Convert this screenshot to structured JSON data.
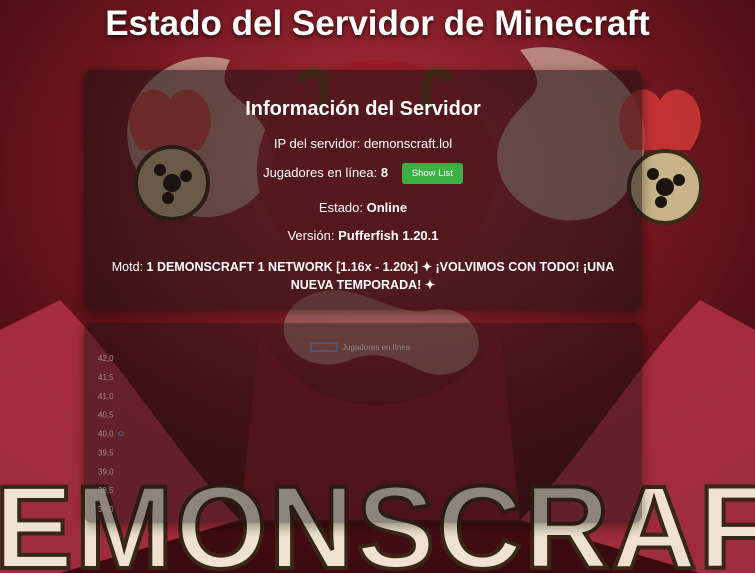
{
  "title": "Estado del Servidor de Minecraft",
  "info": {
    "heading": "Información del Servidor",
    "ip_label": "IP del servidor:",
    "ip_value": "demonscraft.lol",
    "players_label": "Jugadores en línea:",
    "players_value": "8",
    "show_list_button": "Show List",
    "status_label": "Estado:",
    "status_value": "Online",
    "version_label": "Versión:",
    "version_value": "Pufferfish 1.20.1",
    "motd_label": "Motd:",
    "motd_line1": "1 DEMONSCRAFT 1 NETWORK [1.16x - 1.20x] ✦ ¡VOLVIMOS CON TODO! ¡UNA",
    "motd_line2": "NUEVA TEMPORADA! ✦"
  },
  "background_logo_text": "DEMONSCRAFT",
  "chart_data": {
    "type": "line",
    "series": [
      {
        "name": "Jugadores en línea",
        "values": [
          40.0
        ]
      }
    ],
    "y_ticks": [
      "42,0",
      "41,5",
      "41,0",
      "40,5",
      "40,0",
      "39,5",
      "39,0",
      "38,5",
      "38,0"
    ],
    "ylim": [
      38.0,
      42.0
    ],
    "legend_position": "top-center",
    "grid": false
  },
  "colors": {
    "button_green": "#3cb043",
    "card_background": "rgba(25,18,18,0.55)",
    "series_line": "#4a5a8a"
  }
}
